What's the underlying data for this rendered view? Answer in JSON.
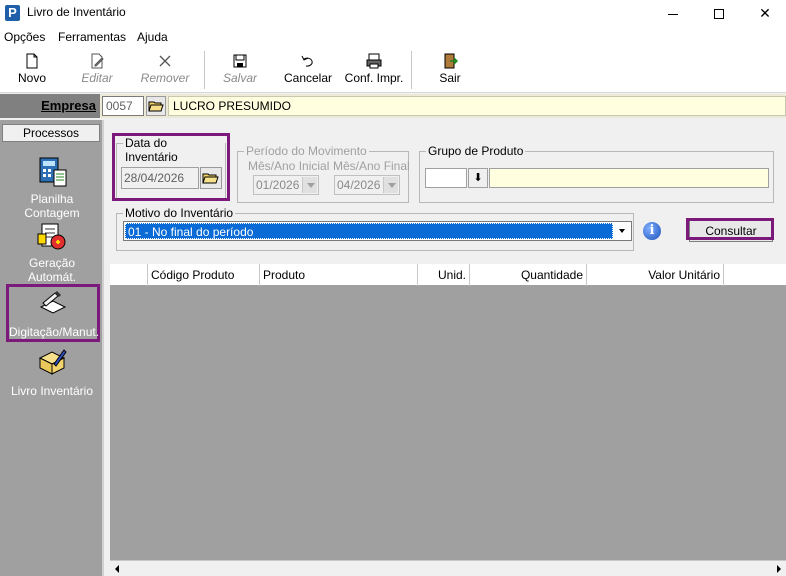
{
  "window": {
    "title": "Livro de Inventário",
    "app_icon_letter": "P"
  },
  "menu": {
    "items": [
      "Opções",
      "Ferramentas",
      "Ajuda"
    ]
  },
  "toolbar": {
    "novo": "Novo",
    "editar": "Editar",
    "remover": "Remover",
    "salvar": "Salvar",
    "cancelar": "Cancelar",
    "conf_impr": "Conf. Impr.",
    "sair": "Sair"
  },
  "empresa": {
    "label": "Empresa",
    "code": "0057",
    "name": "LUCRO PRESUMIDO"
  },
  "sidebar": {
    "header": "Processos",
    "items": [
      {
        "label": "Planilha Contagem",
        "icon": "calculator-spreadsheet-icon"
      },
      {
        "label": "Geração Automát.",
        "icon": "auto-generate-icon"
      },
      {
        "label": "Digitação/Manut.",
        "icon": "hand-writing-icon"
      },
      {
        "label": "Livro Inventário",
        "icon": "book-pen-icon"
      }
    ],
    "selected_index": 2
  },
  "form": {
    "data_inventario": {
      "title": "Data do Inventário",
      "value": "28/04/2026"
    },
    "periodo": {
      "title": "Período do Movimento",
      "inicial_label": "Mês/Ano Inicial",
      "inicial_value": "01/2026",
      "final_label": "Mês/Ano Final",
      "final_value": "04/2026"
    },
    "grupo": {
      "title": "Grupo de Produto",
      "code": "",
      "name": ""
    },
    "motivo": {
      "title": "Motivo do Inventário",
      "value": "01 - No final do período"
    },
    "consultar_label": "Consultar"
  },
  "grid": {
    "columns": [
      "",
      "Código Produto",
      "Produto",
      "Unid.",
      "Quantidade",
      "Valor Unitário",
      ""
    ],
    "rows": []
  },
  "colors": {
    "highlight": "#7b1a7b",
    "selection": "#0a6bd6",
    "yellow_field": "#ffffe0",
    "sidebar_bg": "#a0a0a0"
  }
}
